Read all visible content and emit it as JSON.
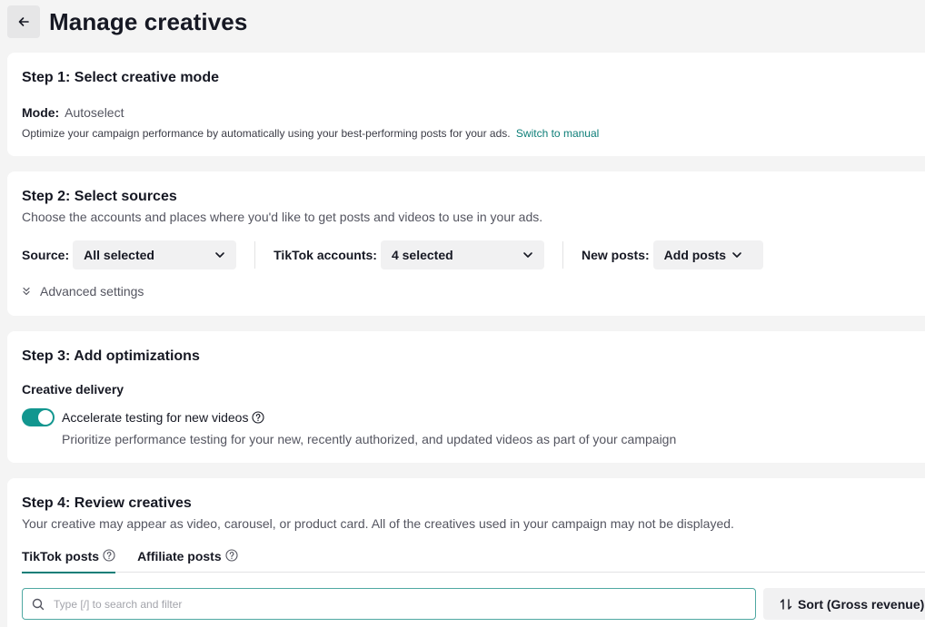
{
  "header": {
    "title": "Manage creatives"
  },
  "step1": {
    "title": "Step 1: Select creative mode",
    "mode_key": "Mode:",
    "mode_value": "Autoselect",
    "description": "Optimize your campaign performance by automatically using your best-performing posts for your ads.",
    "switch_link": "Switch to manual"
  },
  "step2": {
    "title": "Step 2: Select sources",
    "description": "Choose the accounts and places where you'd like to get posts and videos to use in your ads.",
    "source_label": "Source:",
    "source_value": "All selected",
    "accounts_label": "TikTok accounts:",
    "accounts_value": "4 selected",
    "new_posts_label": "New posts:",
    "new_posts_value": "Add posts",
    "advanced": "Advanced settings"
  },
  "step3": {
    "title": "Step 3: Add optimizations",
    "subtitle": "Creative delivery",
    "toggle_label": "Accelerate testing for new videos",
    "toggle_on": true,
    "toggle_description": "Prioritize performance testing for your new, recently authorized, and updated videos as part of your campaign"
  },
  "step4": {
    "title": "Step 4: Review creatives",
    "description": "Your creative may appear as video, carousel, or product card. All of the creatives used in your campaign may not be displayed.",
    "tabs": [
      {
        "label": "TikTok posts",
        "active": true
      },
      {
        "label": "Affiliate posts",
        "active": false
      }
    ],
    "search_placeholder": "Type [/] to search and filter",
    "sort_label": "Sort (Gross revenue)"
  },
  "colors": {
    "accent": "#0d7e78",
    "toggle": "#12968f",
    "text": "#161823",
    "muted": "#545560"
  }
}
